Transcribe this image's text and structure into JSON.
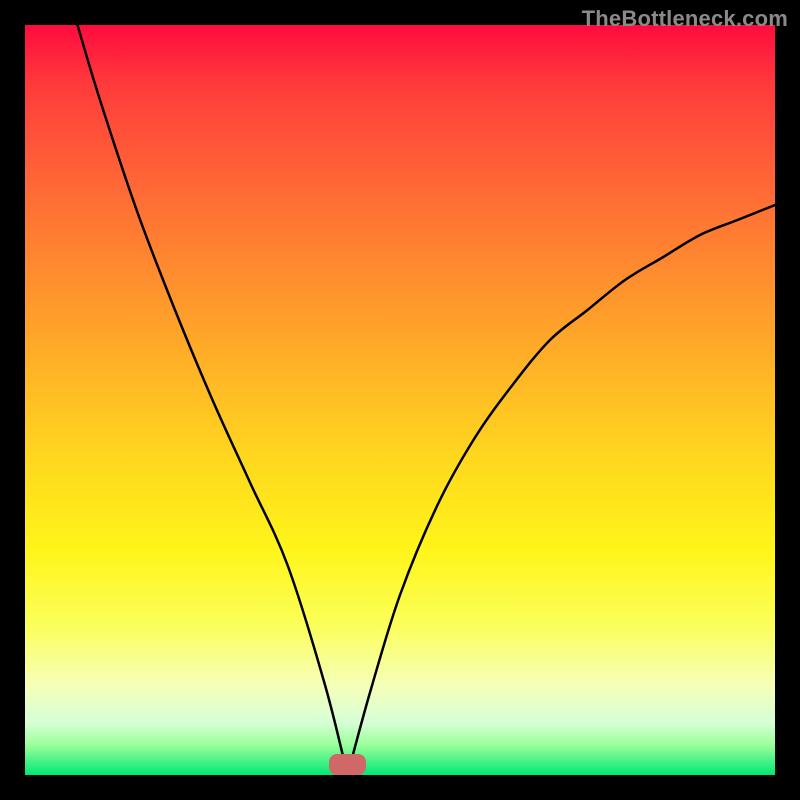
{
  "watermark": "TheBottleneck.com",
  "colors": {
    "curve": "#000000",
    "marker": "#d06868",
    "frame": "#000000"
  },
  "chart_data": {
    "type": "line",
    "title": "",
    "xlabel": "",
    "ylabel": "",
    "xlim": [
      0,
      100
    ],
    "ylim": [
      0,
      100
    ],
    "grid": false,
    "legend": false,
    "min_x": 43,
    "min_y": 0,
    "marker": {
      "x": 43,
      "width": 5,
      "height": 2
    },
    "left_branch_top": {
      "x": 7,
      "y": 100
    },
    "right_branch_end": {
      "x": 100,
      "y": 76
    },
    "series": [
      {
        "name": "bottleneck",
        "x": [
          7,
          10,
          15,
          20,
          25,
          30,
          35,
          40,
          43,
          46,
          50,
          55,
          60,
          65,
          70,
          75,
          80,
          85,
          90,
          95,
          100
        ],
        "y": [
          100,
          90,
          75,
          62,
          50,
          39,
          28,
          12,
          0,
          11,
          24,
          36,
          45,
          52,
          58,
          62,
          66,
          69,
          72,
          74,
          76
        ]
      }
    ]
  }
}
